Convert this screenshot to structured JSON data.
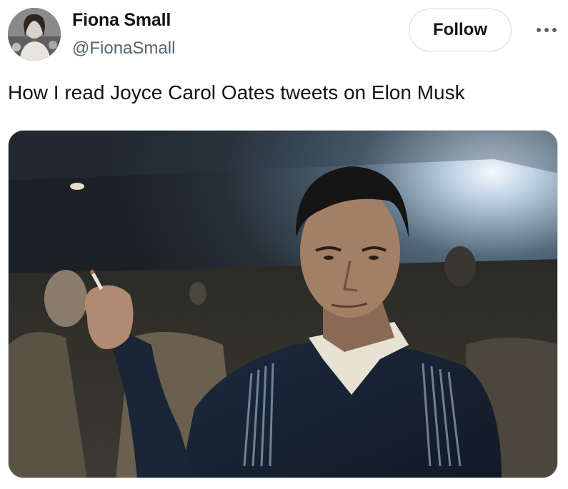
{
  "tweet": {
    "author": {
      "display_name": "Fiona Small",
      "handle": "@FionaSmall",
      "avatar_icon": "profile-photo"
    },
    "follow_label": "Follow",
    "more_icon": "more-horizontal-icon",
    "text": "How I read Joyce Carol Oates tweets on Elon Musk",
    "media": {
      "type": "image"
    }
  },
  "colors": {
    "text_primary": "#0f1419",
    "text_secondary": "#536471",
    "border": "#cfd9de"
  }
}
